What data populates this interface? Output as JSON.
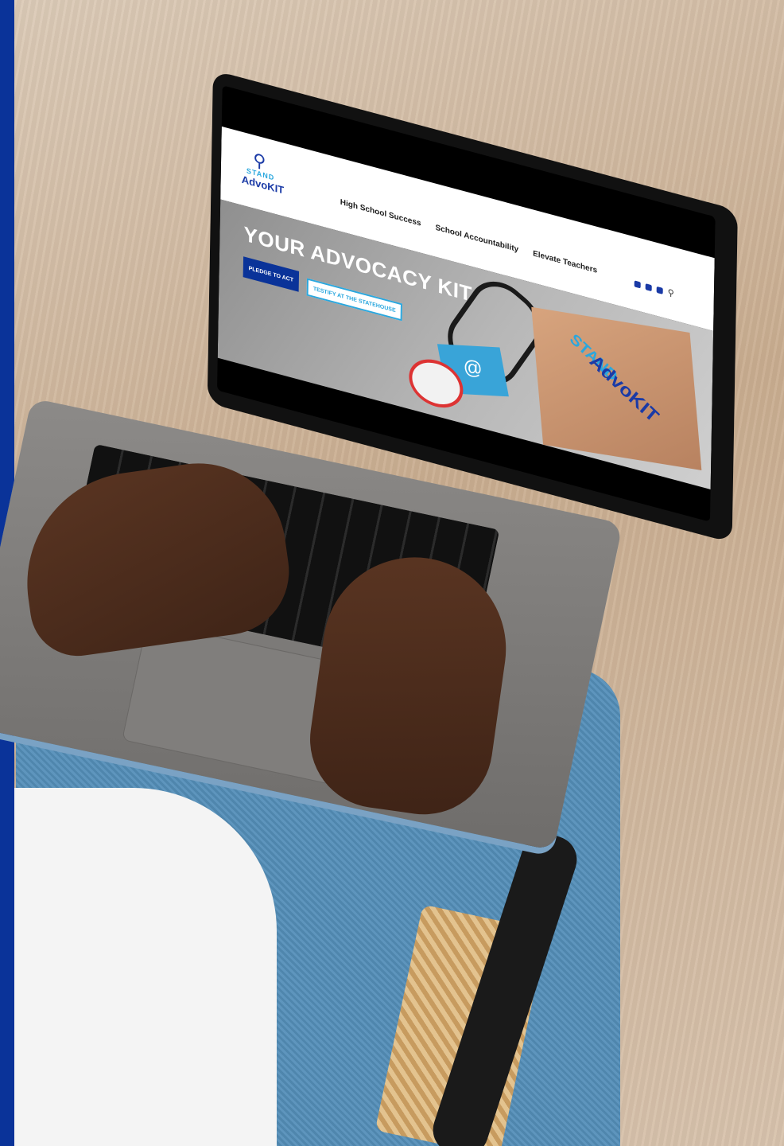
{
  "site": {
    "logo": {
      "stand": "STAND",
      "advokit": "AdvoKIT"
    },
    "nav": [
      "High School Success",
      "School Accountability",
      "Elevate Teachers"
    ],
    "search_icon": "search-icon",
    "social_icons": [
      "facebook-icon",
      "twitter-icon",
      "instagram-icon"
    ]
  },
  "hero": {
    "title": "YOUR ADVOCACY KIT",
    "buttons": {
      "pledge": "PLEDGE TO ACT",
      "testify": "TESTIFY AT THE STATEHOUSE"
    },
    "box": {
      "stand": "STAND",
      "advokit": "AdvoKIT"
    }
  },
  "colors": {
    "brand_blue": "#0a3399",
    "brand_cyan": "#2aa7de"
  }
}
